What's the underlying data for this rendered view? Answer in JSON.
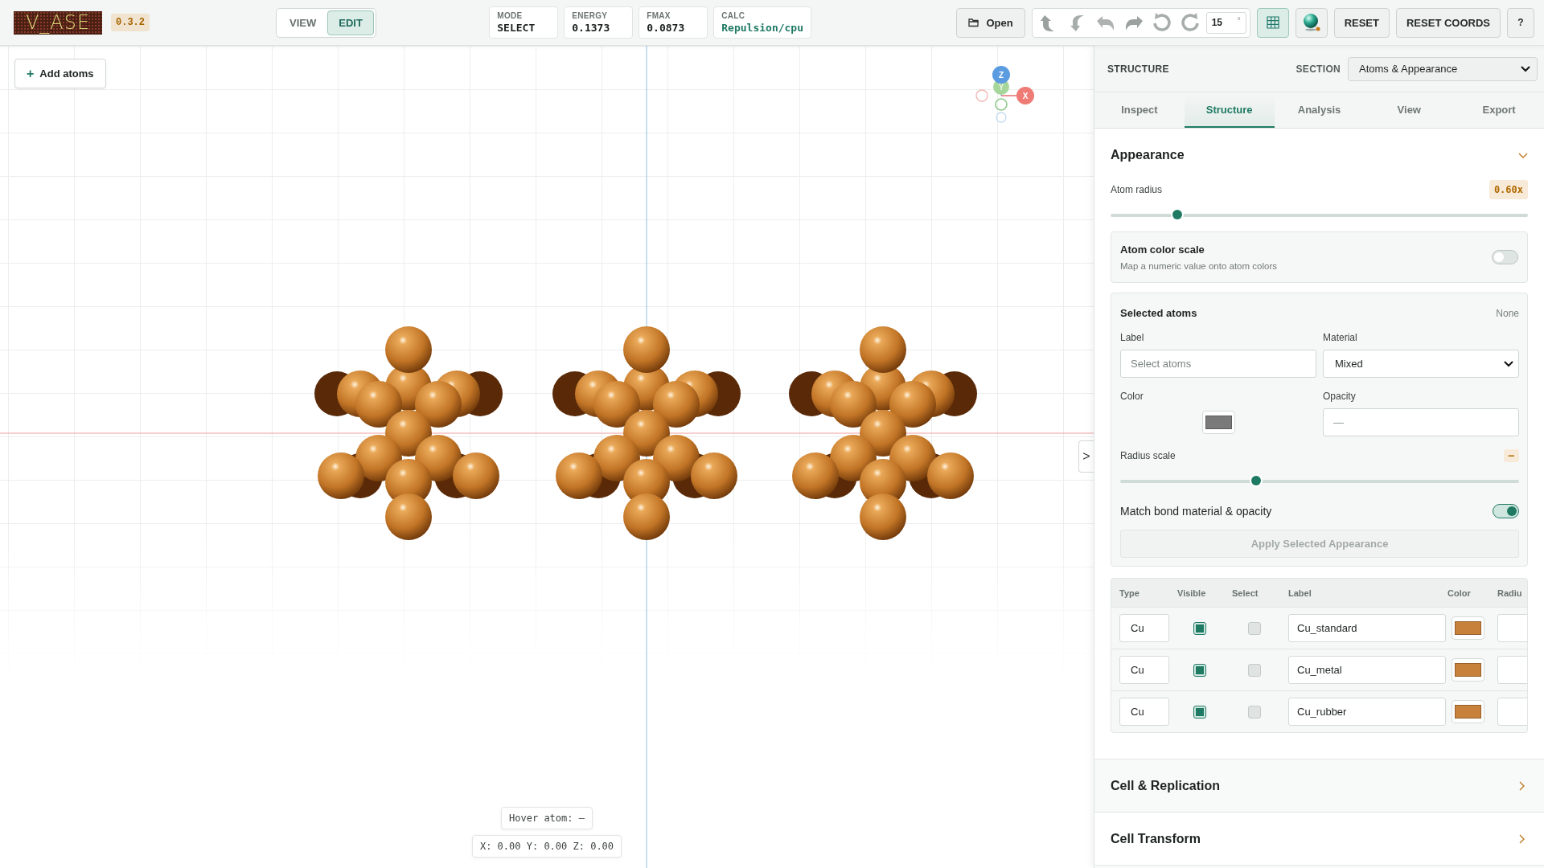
{
  "app": {
    "logo": "V_ASE",
    "version": "0.3.2"
  },
  "mode_toggle": [
    {
      "label": "VIEW",
      "selected": false
    },
    {
      "label": "EDIT",
      "selected": true
    }
  ],
  "stats": [
    {
      "label": "MODE",
      "value": "SELECT",
      "kind": "plain"
    },
    {
      "label": "ENERGY",
      "value": "0.1373",
      "kind": "plain"
    },
    {
      "label": "FMAX",
      "value": "0.0873",
      "kind": "plain"
    },
    {
      "label": "CALC",
      "value": "Repulsion/cpu",
      "kind": "accent"
    }
  ],
  "toolbar": {
    "open": "Open",
    "angle": "15",
    "angle_unit": "°",
    "grid_on": true,
    "reset": "RESET",
    "reset_coords": "RESET COORDS",
    "help": "?"
  },
  "viewport": {
    "add_icon": "+",
    "add_atoms": "Add atoms",
    "axes": [
      "Z",
      "Y",
      "X"
    ],
    "hover": "Hover atom: –",
    "coords": "X: 0.00 Y: 0.00 Z: 0.00",
    "collapse": ">"
  },
  "panel": {
    "title": "STRUCTURE",
    "section_label": "SECTION",
    "section": "Atoms & Appearance",
    "tabs": [
      {
        "label": "Inspect",
        "selected": false
      },
      {
        "label": "Structure",
        "selected": true
      },
      {
        "label": "Analysis",
        "selected": false
      },
      {
        "label": "View",
        "selected": false
      },
      {
        "label": "Export",
        "selected": false
      }
    ],
    "appearance": {
      "title": "Appearance",
      "expanded": true,
      "atom_radius": {
        "label": "Atom radius",
        "reading": "0.60x",
        "level": 0.16
      },
      "color_scale": {
        "title": "Atom color scale",
        "description": "Map a numeric value onto atom colors",
        "on": false
      },
      "selected_atoms": {
        "title": "Selected atoms",
        "count": "None",
        "label_label": "Label",
        "label_placeholder": "Select atoms",
        "material_label": "Material",
        "material": "Mixed",
        "color_label": "Color",
        "opacity_label": "Opacity",
        "opacity": "—",
        "radius_scale": {
          "label": "Radius scale",
          "reading": "–",
          "level": 0.34
        },
        "match_label": "Match bond material & opacity",
        "match_on": true,
        "apply": "Apply Selected Appearance",
        "apply_disabled": true
      },
      "table": {
        "columns": [
          "Type",
          "Visible",
          "Select",
          "Label",
          "Color",
          "Radiu"
        ],
        "rows": [
          {
            "type": "Cu",
            "visible": true,
            "selected": false,
            "label": "Cu_standard",
            "color": "#c8813a"
          },
          {
            "type": "Cu",
            "visible": true,
            "selected": false,
            "label": "Cu_metal",
            "color": "#c8813a"
          },
          {
            "type": "Cu",
            "visible": true,
            "selected": false,
            "label": "Cu_rubber",
            "color": "#c8813a"
          }
        ]
      }
    },
    "sections": [
      {
        "title": "Cell & Replication",
        "expanded": false
      },
      {
        "title": "Cell Transform",
        "expanded": false
      }
    ]
  }
}
